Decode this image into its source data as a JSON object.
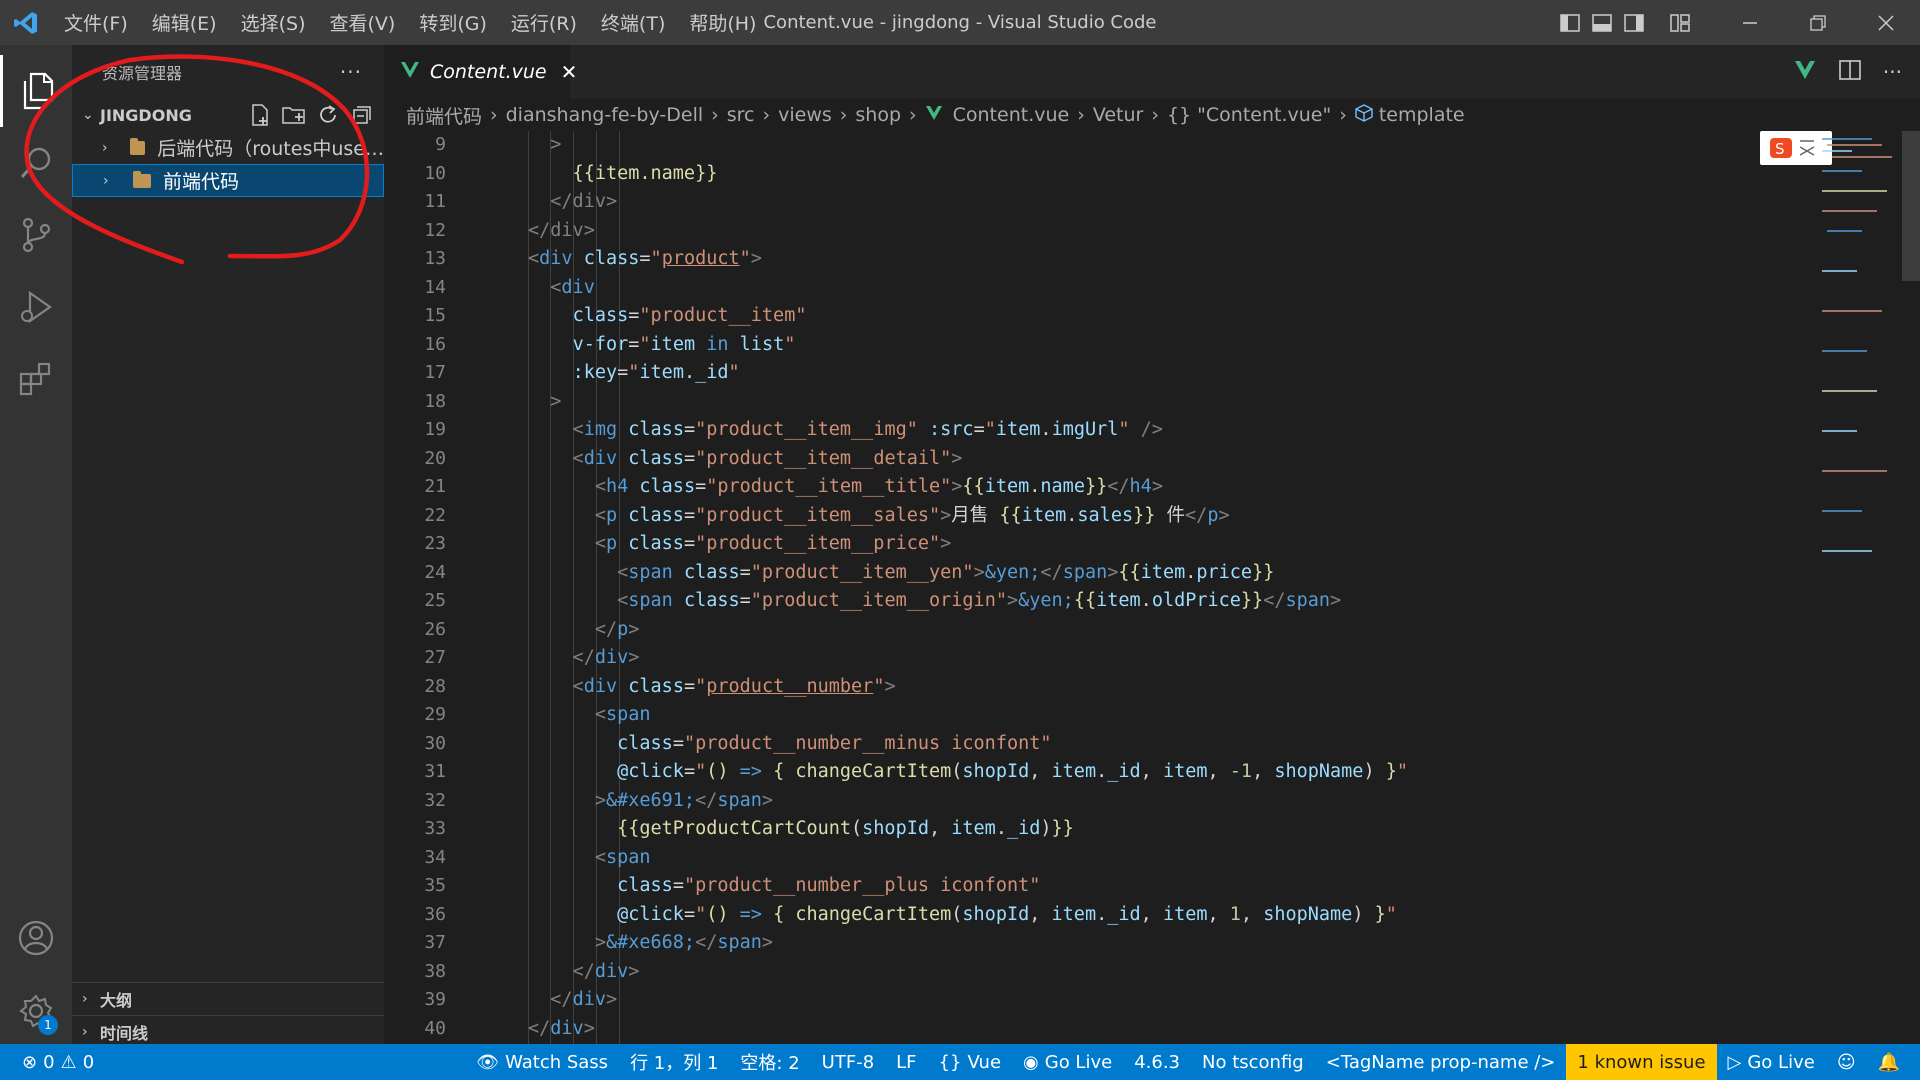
{
  "window": {
    "title": "Content.vue - jingdong - Visual Studio Code",
    "menus": [
      "文件(F)",
      "编辑(E)",
      "选择(S)",
      "查看(V)",
      "转到(G)",
      "运行(R)",
      "终端(T)",
      "帮助(H)"
    ]
  },
  "sidebar": {
    "title": "资源管理器",
    "more": "···",
    "root": "JINGDONG",
    "items": [
      {
        "label": "后端代码（routes中use…",
        "selected": false
      },
      {
        "label": "前端代码",
        "selected": true
      }
    ],
    "outline": "大纲",
    "timeline": "时间线"
  },
  "activity": {
    "settings_badge": "1"
  },
  "tab": {
    "name": "Content.vue",
    "close": "✕"
  },
  "breadcrumb": [
    "前端代码",
    "dianshang-fe-by-Dell",
    "src",
    "views",
    "shop",
    "Content.vue",
    "Vetur",
    "{} \"Content.vue\"",
    "template"
  ],
  "editor": {
    "line_numbers": [
      "9",
      "10",
      "11",
      "12",
      "13",
      "14",
      "15",
      "16",
      "17",
      "18",
      "19",
      "20",
      "21",
      "22",
      "23",
      "24",
      "25",
      "26",
      "27",
      "28",
      "29",
      "30",
      "31",
      "32",
      "33",
      "34",
      "35",
      "36",
      "37",
      "38",
      "39",
      "40"
    ]
  },
  "statusbar": {
    "errors": "0",
    "warnings": "0",
    "watch_sass": "Watch Sass",
    "position": "行 1，列 1",
    "spaces": "空格: 2",
    "encoding": "UTF-8",
    "eol": "LF",
    "language": "Vue",
    "go_live_1": "Go Live",
    "version": "4.6.3",
    "tsconfig": "No tsconfig",
    "tagname": "<TagName prop-name />",
    "issue": "1 known issue",
    "go_live_2": "Go Live"
  },
  "colors": {
    "accent": "#007acc",
    "annotation": "#e21c1c",
    "issue": "#ffc600"
  }
}
